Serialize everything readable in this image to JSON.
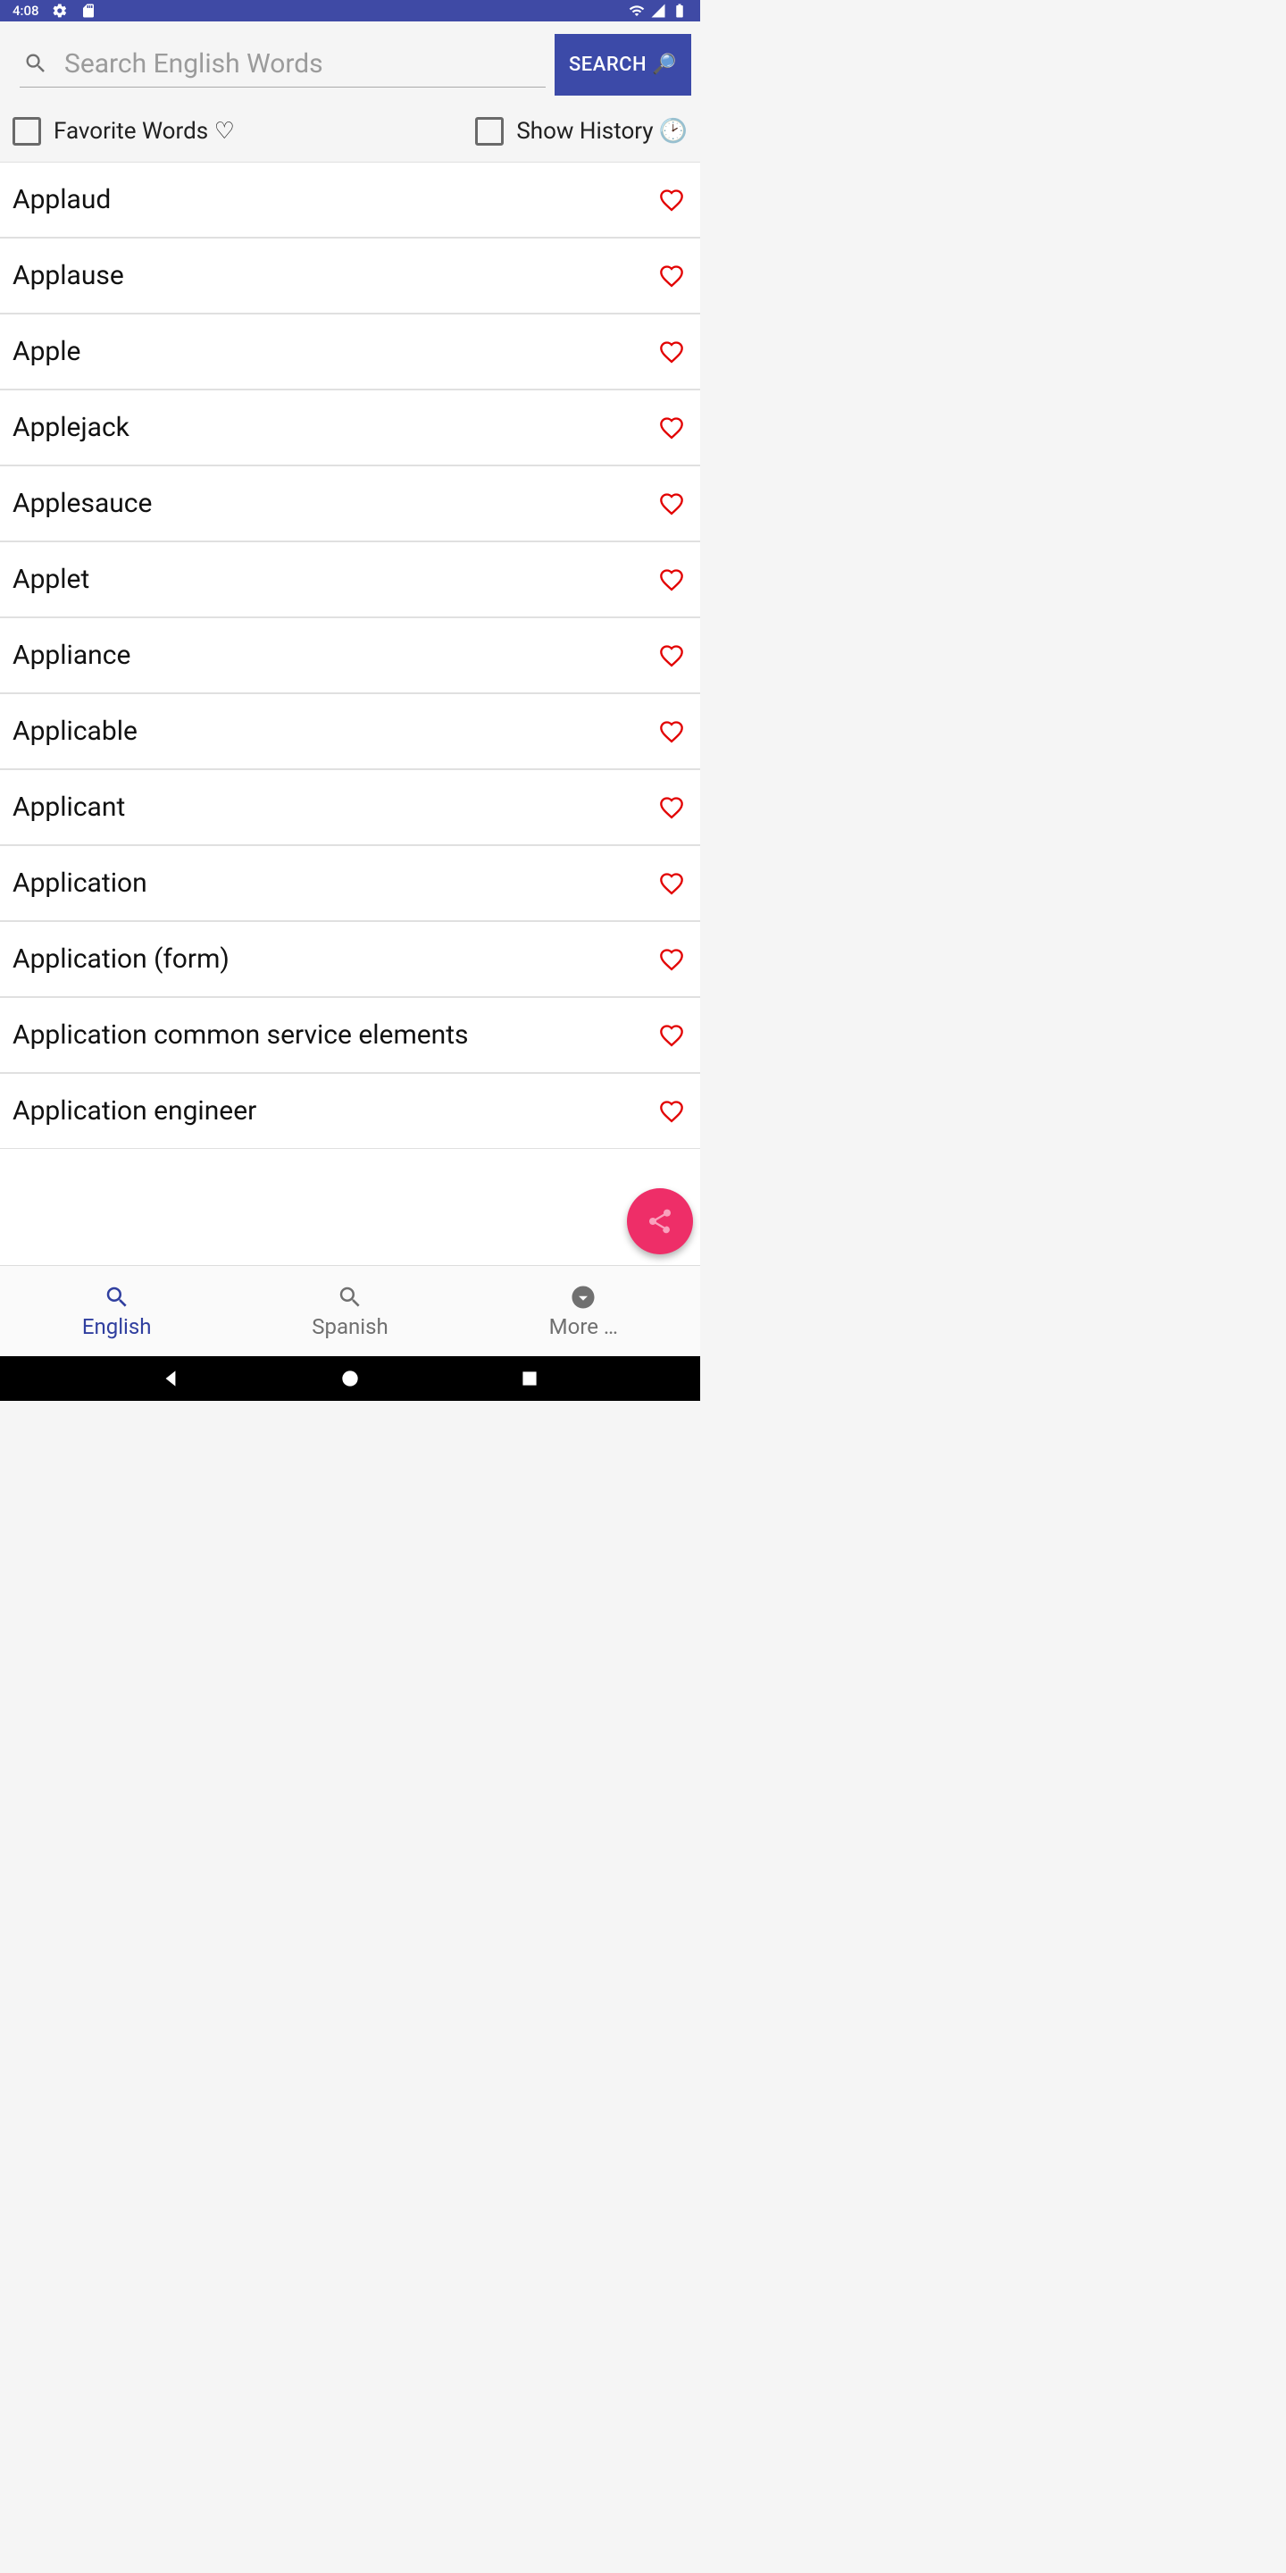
{
  "statusBar": {
    "time": "4:08"
  },
  "search": {
    "placeholder": "Search English Words",
    "buttonLabel": "SEARCH 🔎"
  },
  "filters": {
    "favoriteLabel": "Favorite Words ♡",
    "historyLabel": "Show History",
    "historyIcon": "🕑"
  },
  "words": [
    "Applaud",
    "Applause",
    "Apple",
    "Applejack",
    "Applesauce",
    "Applet",
    "Appliance",
    "Applicable",
    "Applicant",
    "Application",
    "Application (form)",
    "Application common service elements",
    "Application engineer"
  ],
  "nav": {
    "english": "English",
    "spanish": "Spanish",
    "more": "More …"
  }
}
